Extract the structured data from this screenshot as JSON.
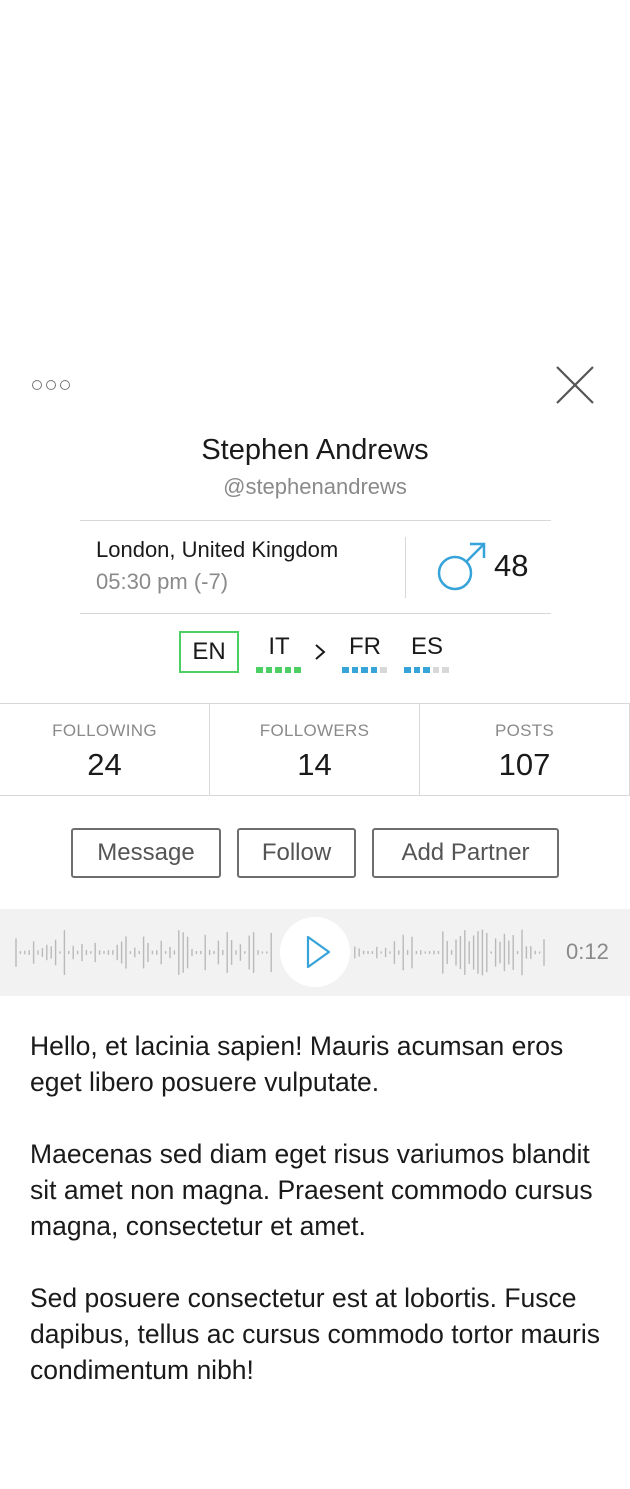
{
  "profile": {
    "name": "Stephen Andrews",
    "handle": "@stephenandrews",
    "location": "London, United Kingdom",
    "local_time": "05:30 pm (-7)",
    "gender_icon": "male-symbol-icon",
    "age": "48"
  },
  "languages": {
    "native": "EN",
    "learning_from": "IT",
    "arrow_icon": "chevron-right-icon",
    "targets": [
      "FR",
      "ES"
    ],
    "levels": {
      "IT": 5,
      "FR": 4,
      "ES": 3
    },
    "level_max": 5
  },
  "stats": [
    {
      "label": "FOLLOWING",
      "value": "24"
    },
    {
      "label": "FOLLOWERS",
      "value": "14"
    },
    {
      "label": "POSTS",
      "value": "107"
    }
  ],
  "actions": {
    "message": "Message",
    "follow": "Follow",
    "add_partner": "Add Partner"
  },
  "audio": {
    "duration": "0:12",
    "play_icon": "play-icon"
  },
  "bio": [
    "Hello, et lacinia sapien! Mauris acumsan eros eget libero posuere vulputate.",
    "Maecenas sed diam eget risus variumos blandit sit amet non magna. Praesent commodo cursus magna, consectetur et amet.",
    "Sed posuere consectetur est at lobortis. Fusce dapibus, tellus ac cursus commodo tortor mauris condimentum nibh!"
  ],
  "colors": {
    "native_border": "#4cd063",
    "level_green": "#4cd063",
    "level_blue": "#36a3d9",
    "level_empty": "#d8d8d8",
    "accent_blue": "#36a3d9"
  },
  "icons": {
    "more": "more-options-icon",
    "close": "close-icon"
  }
}
